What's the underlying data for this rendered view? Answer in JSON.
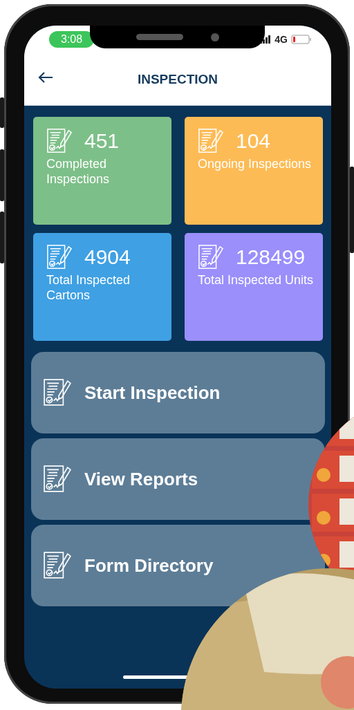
{
  "status_bar": {
    "time": "3:08",
    "network": "4G"
  },
  "header": {
    "title": "INSPECTION"
  },
  "stats": [
    {
      "value": "451",
      "label": "Completed Inspections",
      "color": "#7dbf88"
    },
    {
      "value": "104",
      "label": "Ongoing Inspections",
      "color": "#fdbb55"
    },
    {
      "value": "4904",
      "label": "Total Inspected Cartons",
      "color": "#3fa0e3"
    },
    {
      "value": "128499",
      "label": "Total Inspected Units",
      "color": "#9a8ffb"
    }
  ],
  "actions": [
    {
      "label": "Start Inspection"
    },
    {
      "label": "View Reports"
    },
    {
      "label": "Form Directory"
    }
  ]
}
